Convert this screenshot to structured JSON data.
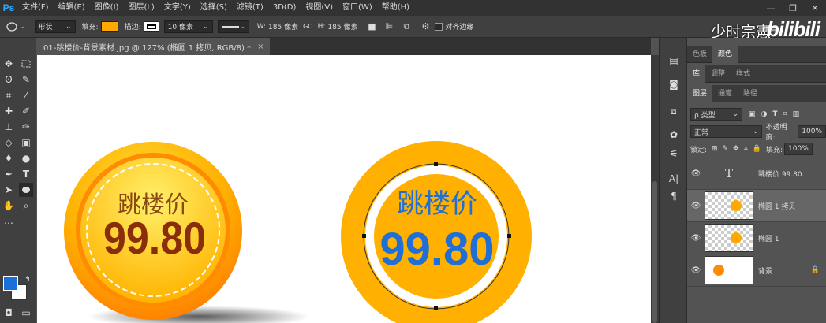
{
  "app": {
    "logo": "Ps"
  },
  "menu": [
    "文件(F)",
    "编辑(E)",
    "图像(I)",
    "图层(L)",
    "文字(Y)",
    "选择(S)",
    "滤镜(T)",
    "3D(D)",
    "视图(V)",
    "窗口(W)",
    "帮助(H)"
  ],
  "window_controls": [
    "—",
    "❐",
    "✕"
  ],
  "options": {
    "mode": "形状",
    "fill_label": "填充:",
    "fill_color": "#ffa800",
    "stroke_label": "描边:",
    "stroke_width": "10 像素",
    "w_label": "W:",
    "w_value": "185 像素",
    "link": "GO",
    "h_label": "H:",
    "h_value": "185 像素",
    "align_edges": "对齐边缘"
  },
  "branding": {
    "text": "少时宗憲",
    "sub": "拼音",
    "bili": "bilibili"
  },
  "document": {
    "tab": "01-跳楼价-背景素材.jpg @ 127% (椭圆 1 拷贝, RGB/8) *",
    "close": "×"
  },
  "canvas": {
    "badge_left": {
      "title": "跳楼价",
      "price": "99.80"
    },
    "badge_right": {
      "title": "跳楼价",
      "price": "99.80"
    }
  },
  "colors": {
    "foreground": "#1a6fd9",
    "background": "#ffffff",
    "accent": "#ffa800",
    "price_blue": "#1f6fd6",
    "price_brown": "#8a2d0a"
  },
  "panels": {
    "top_tabs": [
      "色板",
      "颜色"
    ],
    "mid_tabs": [
      "库",
      "调整",
      "样式"
    ],
    "layer_tabs": [
      "图层",
      "通道",
      "路径"
    ],
    "filter": "ρ 类型",
    "blend": "正常",
    "opacity_label": "不透明度:",
    "opacity": "100%",
    "lock_label": "锁定:",
    "fill_label": "填充:",
    "fill": "100%"
  },
  "layers": [
    {
      "name": "跳楼价 99.80",
      "kind": "text",
      "thumb": "T"
    },
    {
      "name": "椭圆 1 拷贝",
      "kind": "shape"
    },
    {
      "name": "椭圆 1",
      "kind": "shape"
    },
    {
      "name": "背景",
      "kind": "bg",
      "lock": "🔒"
    }
  ]
}
